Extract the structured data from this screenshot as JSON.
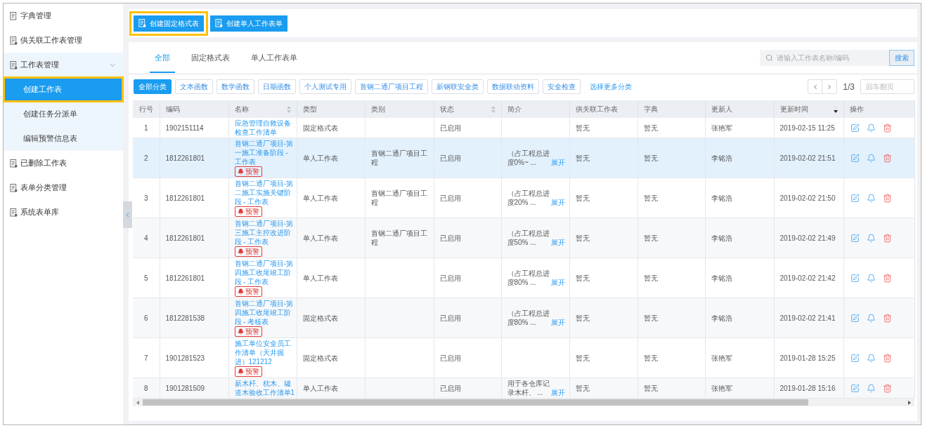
{
  "toolbar": {
    "buttons": [
      {
        "label": "创建固定格式表",
        "highlighted": true
      },
      {
        "label": "创建单人工作表单",
        "highlighted": false
      }
    ]
  },
  "sidebar": {
    "items": [
      {
        "label": "字典管理",
        "selected": false,
        "highlighted": false
      },
      {
        "label": "供关联工作表管理",
        "selected": false,
        "highlighted": false
      },
      {
        "label": "工作表管理",
        "selected": false,
        "highlighted": false,
        "expanded": true,
        "children": [
          {
            "label": "创建工作表",
            "selected": true,
            "highlighted": true
          },
          {
            "label": "创建任务分派单",
            "selected": false,
            "highlighted": false
          },
          {
            "label": "编辑预警信息表",
            "selected": false,
            "highlighted": false
          }
        ]
      },
      {
        "label": "已删除工作表",
        "selected": false,
        "highlighted": false
      },
      {
        "label": "表单分类管理",
        "selected": false,
        "highlighted": false
      },
      {
        "label": "系统表单库",
        "selected": false,
        "highlighted": false
      }
    ]
  },
  "tabs": [
    {
      "label": "全部",
      "selected": true
    },
    {
      "label": "固定格式表",
      "selected": false
    },
    {
      "label": "单人工作表单",
      "selected": false
    }
  ],
  "search": {
    "placeholder": "请输入工作表名称/编码",
    "button": "搜索"
  },
  "categories": {
    "chips": [
      {
        "label": "全部分类",
        "selected": true
      },
      {
        "label": "文本函数",
        "selected": false
      },
      {
        "label": "数学函数",
        "selected": false
      },
      {
        "label": "日期函数",
        "selected": false
      },
      {
        "label": "个人测试专用",
        "selected": false
      },
      {
        "label": "首钢二通厂项目工程",
        "selected": false
      },
      {
        "label": "新钢联安全类",
        "selected": false
      },
      {
        "label": "数据联动资料",
        "selected": false
      },
      {
        "label": "安全检查",
        "selected": false
      }
    ],
    "more_link": "选择更多分类"
  },
  "pagination": {
    "page": "1/3",
    "placeholder": "回车翻页"
  },
  "table": {
    "columns": [
      {
        "label": "行号"
      },
      {
        "label": "编码"
      },
      {
        "label": "名称",
        "sortable": true,
        "sorted": false
      },
      {
        "label": "类型"
      },
      {
        "label": "类别"
      },
      {
        "label": "状态",
        "sortable": true,
        "sorted": false
      },
      {
        "label": "简介"
      },
      {
        "label": "供关联工作表"
      },
      {
        "label": "字典"
      },
      {
        "label": "更新人"
      },
      {
        "label": "更新时间",
        "sortable": true,
        "sorted": true
      },
      {
        "label": "操作"
      }
    ],
    "rows": [
      {
        "no": "1",
        "code": "1902151114",
        "name": "应急管理自救设备检查工作清单",
        "type": "固定格式表",
        "status": "已启用",
        "linked_sheet": "暂无",
        "dictionary": "暂无",
        "updated_by": "张艳军",
        "updated_at": "2019-02-15 11:25",
        "hovered": false
      },
      {
        "no": "2",
        "code": "1812261801",
        "name": "首钢二通厂项目-第一施工准备阶段 - 工作表",
        "badge": "预警",
        "type": "单人工作表",
        "category": "首钢二通厂项目工程",
        "status": "已启用",
        "summary": "（占工程总进度0%~ ...",
        "expand_link": "展开",
        "linked_sheet": "暂无",
        "dictionary": "暂无",
        "updated_by": "李铭浩",
        "updated_at": "2019-02-02 21:51",
        "hovered": true
      },
      {
        "no": "3",
        "code": "1812261801",
        "name": "首钢二通厂项目-第二施工实施关键阶段 - 工作表",
        "badge": "预警",
        "type": "单人工作表",
        "category": "首钢二通厂项目工程",
        "status": "已启用",
        "summary": "（占工程总进度20% ...",
        "expand_link": "展开",
        "linked_sheet": "暂无",
        "dictionary": "暂无",
        "updated_by": "李铭浩",
        "updated_at": "2019-02-02 21:50",
        "hovered": false
      },
      {
        "no": "4",
        "code": "1812261801",
        "name": "首钢二通厂项目-第三施工主控改进阶段 - 工作表",
        "badge": "预警",
        "type": "单人工作表",
        "category": "首钢二通厂项目工程",
        "status": "已启用",
        "summary": "（占工程总进度50% ...",
        "expand_link": "展开",
        "linked_sheet": "暂无",
        "dictionary": "暂无",
        "updated_by": "李铭浩",
        "updated_at": "2019-02-02 21:49",
        "hovered": false
      },
      {
        "no": "5",
        "code": "1812261801",
        "name": "首钢二通厂项目-第四施工收尾竣工阶段 - 工作表",
        "badge": "预警",
        "type": "单人工作表",
        "status": "已启用",
        "summary": "（占工程总进度80% ...",
        "expand_link": "展开",
        "linked_sheet": "暂无",
        "dictionary": "暂无",
        "updated_by": "李铭浩",
        "updated_at": "2019-02-02 21:42",
        "hovered": false
      },
      {
        "no": "6",
        "code": "1812281538",
        "name": "首钢二通厂项目-第四施工收尾竣工阶段 - 考核表",
        "badge": "预警",
        "type": "固定格式表",
        "status": "已启用",
        "summary": "（占工程总进度80% ...",
        "expand_link": "展开",
        "linked_sheet": "暂无",
        "dictionary": "暂无",
        "updated_by": "李铭浩",
        "updated_at": "2019-02-02 21:41",
        "hovered": false
      },
      {
        "no": "7",
        "code": "1901281523",
        "name": "施工单位安全员工作清单（天井掘进）121212",
        "badge": "预警",
        "type": "固定格式表",
        "status": "已启用",
        "linked_sheet": "暂无",
        "dictionary": "暂无",
        "updated_by": "张艳军",
        "updated_at": "2019-01-28 15:25",
        "hovered": false
      },
      {
        "no": "8",
        "code": "1901281509",
        "name": "新木杆、枕木、罐道木验收工作清单1",
        "type": "单人工作表",
        "status": "已启用",
        "summary": "用于各仓库记录木杆、 ...",
        "expand_link": "展开",
        "linked_sheet": "暂无",
        "dictionary": "暂无",
        "updated_by": "张艳军",
        "updated_at": "2019-01-28 15:16",
        "hovered": false
      }
    ]
  }
}
